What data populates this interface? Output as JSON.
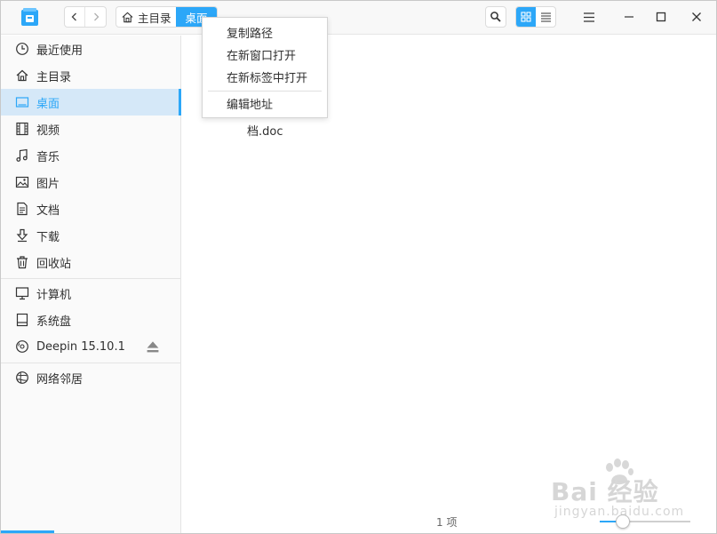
{
  "header": {
    "breadcrumb": [
      {
        "label": "主目录",
        "icon": "home-icon"
      },
      {
        "label": "桌面"
      }
    ]
  },
  "sidebar": {
    "items": [
      {
        "label": "最近使用",
        "icon": "clock-icon"
      },
      {
        "label": "主目录",
        "icon": "home-icon"
      },
      {
        "label": "桌面",
        "icon": "desktop-icon",
        "active": true
      },
      {
        "label": "视频",
        "icon": "film-icon"
      },
      {
        "label": "音乐",
        "icon": "music-note-icon"
      },
      {
        "label": "图片",
        "icon": "picture-icon"
      },
      {
        "label": "文档",
        "icon": "document-icon"
      },
      {
        "label": "下载",
        "icon": "download-arrow-icon"
      },
      {
        "label": "回收站",
        "icon": "trash-icon"
      },
      {
        "label": "计算机",
        "icon": "monitor-icon"
      },
      {
        "label": "系统盘",
        "icon": "drive-icon"
      },
      {
        "label": "Deepin 15.10.1",
        "icon": "disc-icon"
      },
      {
        "label": "网络邻居",
        "icon": "network-icon"
      }
    ]
  },
  "context_menu": {
    "items": [
      {
        "label": "复制路径"
      },
      {
        "label": "在新窗口打开"
      },
      {
        "label": "在新标签中打开"
      },
      {
        "label": "编辑地址"
      }
    ]
  },
  "main": {
    "file_label": "档.doc",
    "status": "1 项",
    "zoom_level": 0.25
  },
  "watermark": {
    "text": "Bai  经验",
    "sub": "jingyan.baidu.com"
  },
  "colors": {
    "accent": "#2ca7f8",
    "selection": "#d5e8f8"
  }
}
